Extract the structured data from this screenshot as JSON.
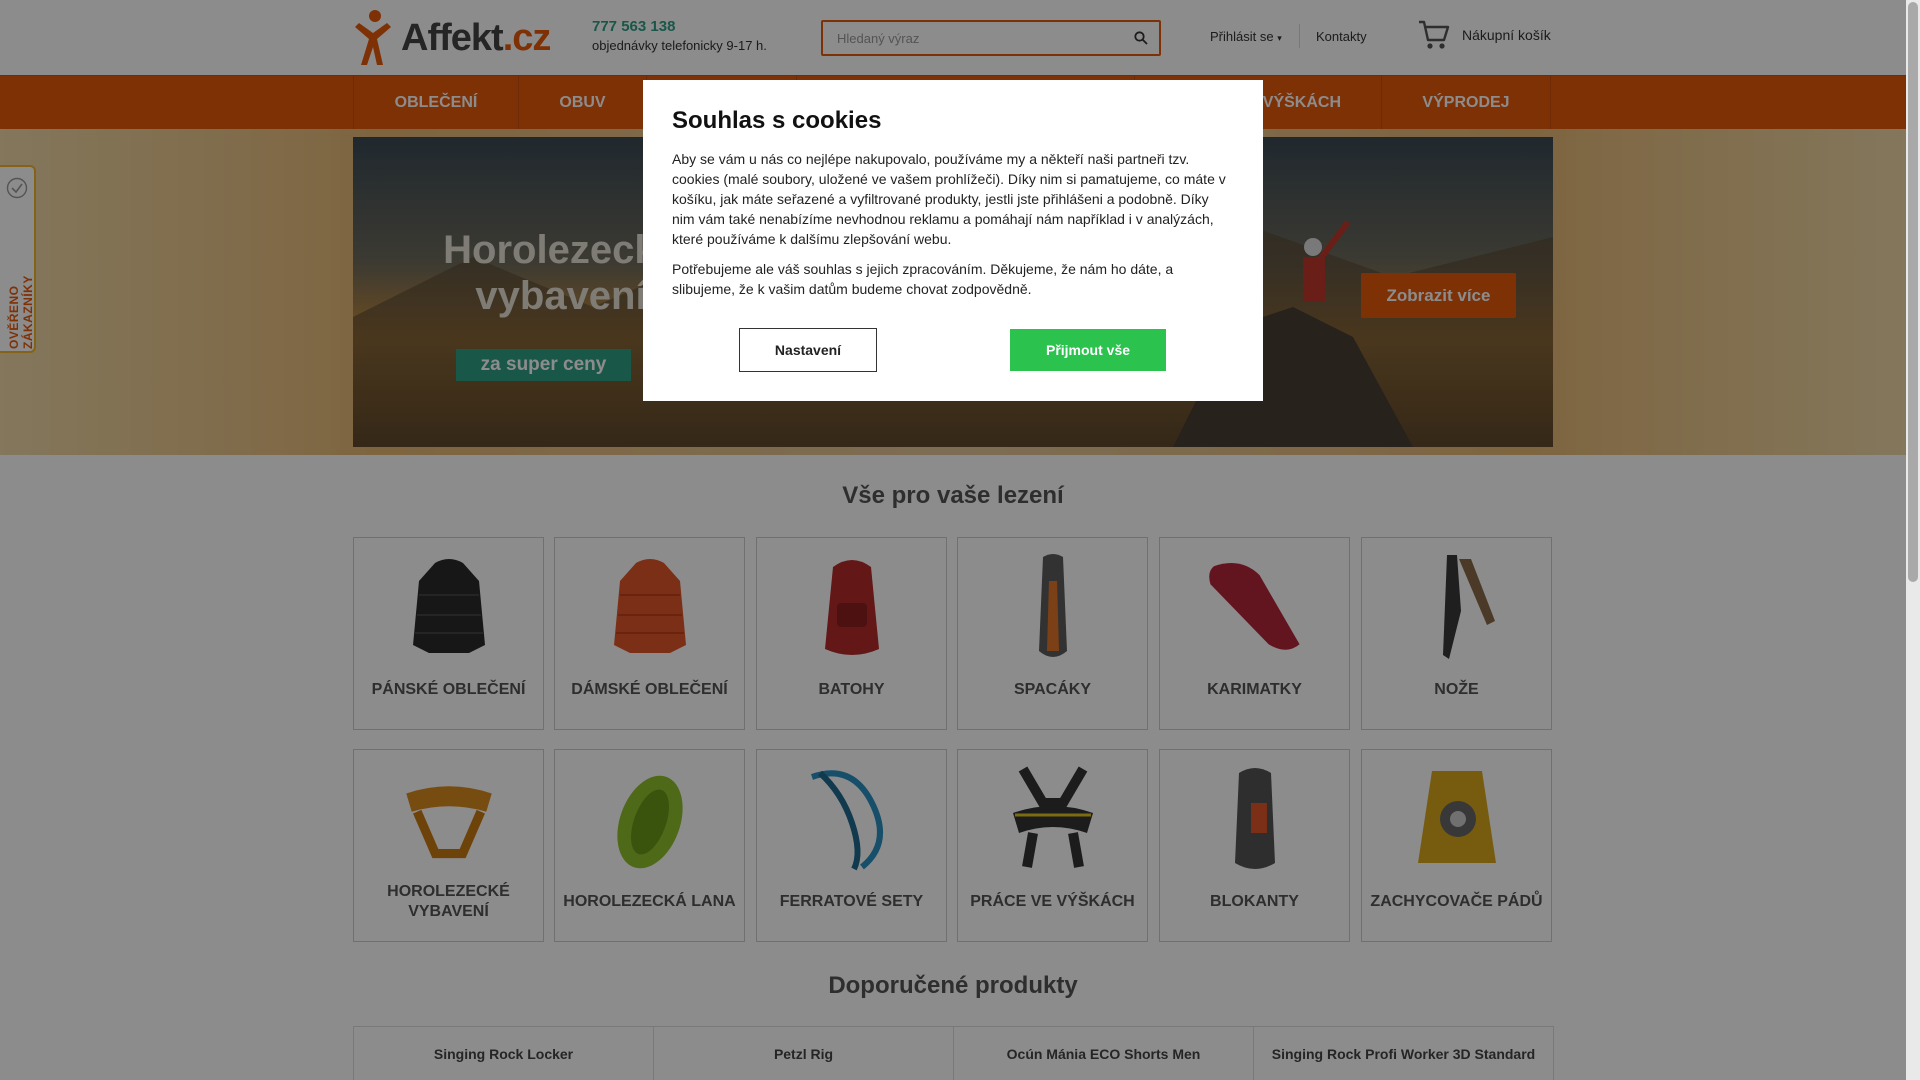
{
  "header": {
    "logo_text_main": "Affekt",
    "logo_text_tld": ".cz",
    "phone_number": "777 563 138",
    "phone_note": "objednávky telefonicky 9-17 h.",
    "search_placeholder": "Hledaný výraz",
    "login_label": "Přihlásit se",
    "contacts_label": "Kontakty",
    "cart_label": "Nákupní košík"
  },
  "nav": {
    "items": [
      {
        "label": "OBLEČENÍ"
      },
      {
        "label": "OBUV"
      },
      {
        "label": ""
      },
      {
        "label": ""
      },
      {
        "label": "VÝŠKÁCH"
      },
      {
        "label": "VÝPRODEJ"
      }
    ]
  },
  "banner": {
    "title_line1": "Horolezecké",
    "title_line2": "vybavení",
    "tag": "za super ceny",
    "button": "Zobrazit více"
  },
  "side_tab": {
    "label": "OVĚŘENO ZÁKAZNÍKY"
  },
  "categories_section": {
    "title": "Vše pro vaše lezení",
    "items": [
      {
        "label": "PÁNSKÉ OBLEČENÍ",
        "icon": "down-jacket-black"
      },
      {
        "label": "DÁMSKÉ OBLEČENÍ",
        "icon": "down-jacket-orange"
      },
      {
        "label": "BATOHY",
        "icon": "backpack-red"
      },
      {
        "label": "SPACÁKY",
        "icon": "sleeping-bag"
      },
      {
        "label": "KARIMATKY",
        "icon": "sleeping-pad"
      },
      {
        "label": "NOŽE",
        "icon": "knife"
      },
      {
        "label": "HOROLEZECKÉ VYBAVENÍ",
        "icon": "harness-orange"
      },
      {
        "label": "HOROLEZECKÁ LANA",
        "icon": "rope-green"
      },
      {
        "label": "FERRATOVÉ SETY",
        "icon": "via-ferrata-set"
      },
      {
        "label": "PRÁCE VE VÝŠKÁCH",
        "icon": "work-harness"
      },
      {
        "label": "BLOKANTY",
        "icon": "ascender"
      },
      {
        "label": "ZACHYCOVAČE PÁDŮ",
        "icon": "fall-arrester"
      }
    ]
  },
  "products_section": {
    "title": "Doporučené produkty",
    "items": [
      {
        "name": "Singing Rock Locker"
      },
      {
        "name": "Petzl Rig"
      },
      {
        "name": "Ocún Mánia ECO Shorts Men"
      },
      {
        "name": "Singing Rock Profi Worker 3D Standard"
      }
    ]
  },
  "cookie_modal": {
    "title": "Souhlas s cookies",
    "paragraph1": "Aby se vám u nás co nejlépe nakupovalo, používáme my a někteří naši partneři tzv. cookies (malé soubory, uložené ve vašem prohlížeči). Díky nim si pamatujeme, co máte v košíku, jak máte seřazené a vyfiltrované produkty, jestli jste přihlášeni a podobně. Díky nim vám také nenabízíme nevhodnou reklamu a pomáhají nám například i v analýzách, které používáme k dalšímu zlepšování webu.",
    "paragraph2": "Potřebujeme ale váš souhlas s jejich zpracováním. Děkujeme, že nám ho dáte, a slibujeme, že k vašim datům budeme chovat zodpovědně.",
    "settings_button": "Nastavení",
    "accept_button": "Přijmout vše"
  },
  "colors": {
    "brand_orange": "#e8590c",
    "phone_green": "#2e9e84",
    "accept_green": "#2bc24e"
  }
}
